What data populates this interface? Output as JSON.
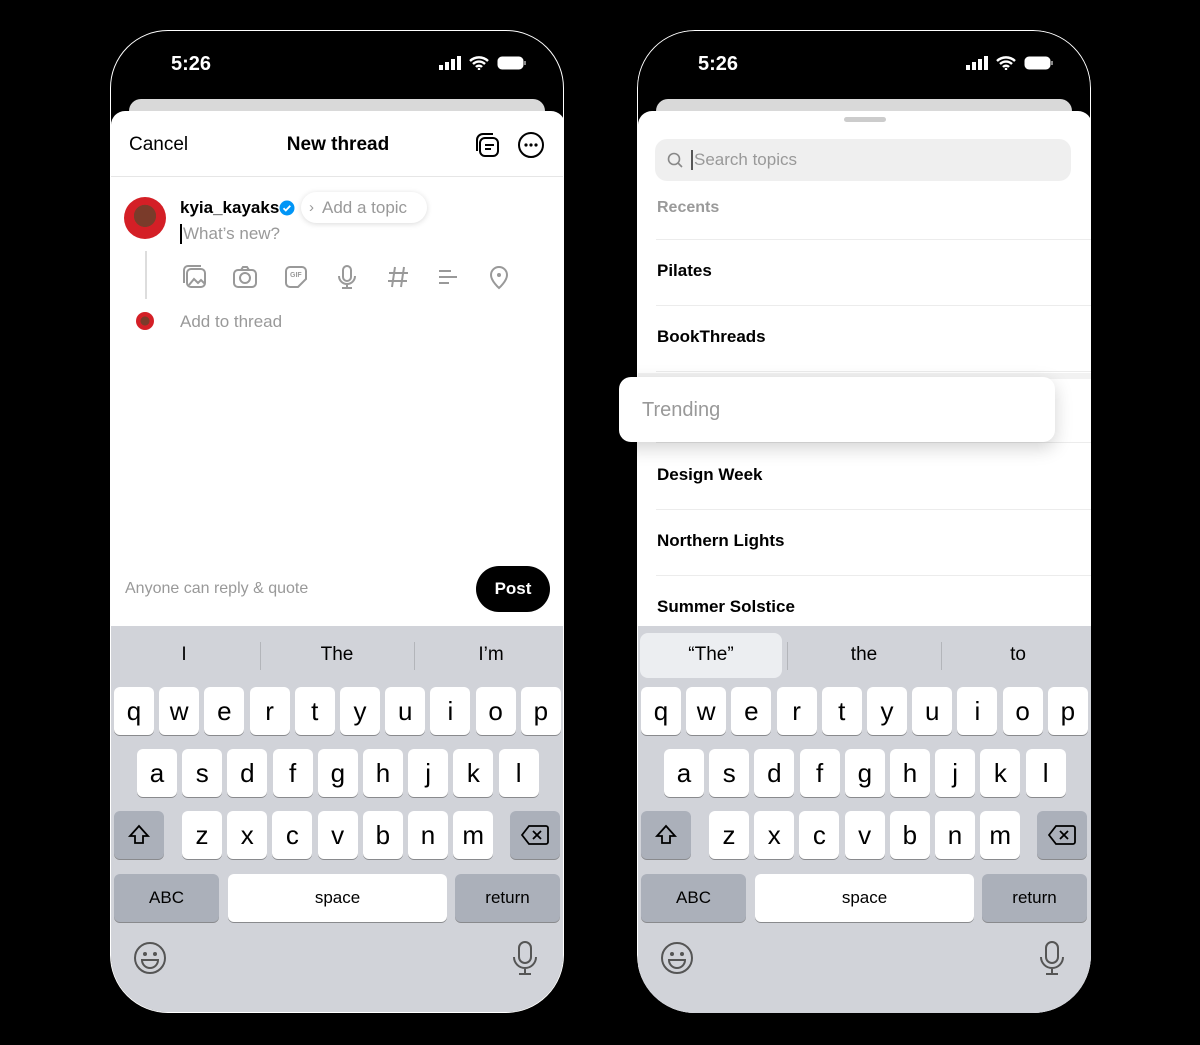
{
  "status_bar": {
    "time": "5:26"
  },
  "composer": {
    "cancel": "Cancel",
    "title": "New thread",
    "username": "kyia_kayaks",
    "topic_placeholder": "Add a topic",
    "body_placeholder": "What’s new?",
    "add_to_thread": "Add to thread",
    "reply_setting": "Anyone can reply & quote",
    "post": "Post",
    "toolbar_icons": [
      "gallery-icon",
      "camera-icon",
      "gif-icon",
      "mic-icon",
      "hashtag-icon",
      "poll-icon",
      "location-icon"
    ],
    "suggestions": [
      "I",
      "The",
      "I’m"
    ]
  },
  "topics": {
    "search_placeholder": "Search topics",
    "recents_label": "Recents",
    "recents": [
      "Pilates",
      "BookThreads"
    ],
    "trending_label": "Trending",
    "trending": [
      "Design Week",
      "Northern Lights",
      "Summer Solstice"
    ],
    "suggestions": [
      "“The”",
      "the",
      "to"
    ]
  },
  "keyboard": {
    "rows": [
      [
        "q",
        "w",
        "e",
        "r",
        "t",
        "y",
        "u",
        "i",
        "o",
        "p"
      ],
      [
        "a",
        "s",
        "d",
        "f",
        "g",
        "h",
        "j",
        "k",
        "l"
      ],
      [
        "z",
        "x",
        "c",
        "v",
        "b",
        "n",
        "m"
      ]
    ],
    "abc": "ABC",
    "space": "space",
    "return": "return"
  },
  "colors": {
    "accent": "#000000",
    "verified": "#0095f6",
    "keyboard_bg": "#d1d3d9"
  }
}
